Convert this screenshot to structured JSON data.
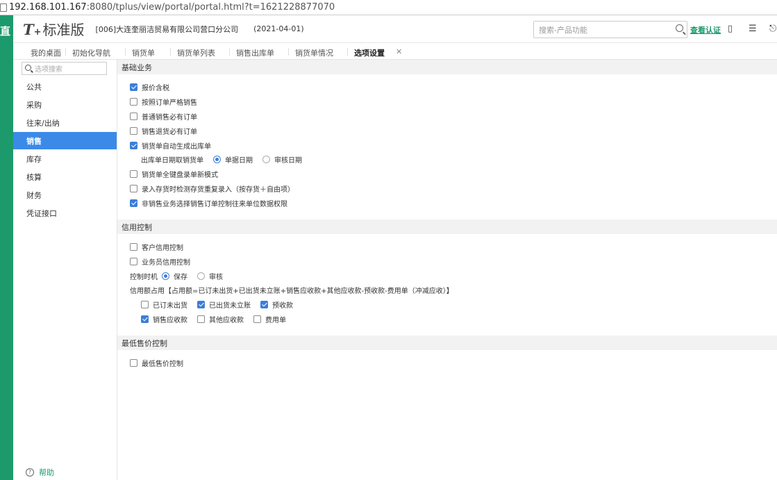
{
  "browser": {
    "url_host": "192.168.101.167",
    "url_path": ":8080/tplus/view/portal/portal.html?t=1621228877070"
  },
  "left_strip": {
    "char": "直"
  },
  "header": {
    "logo_t": "T",
    "logo_plus": "+",
    "logo_text": "标准版",
    "company": "[006]大连奎丽洁贸易有限公司营口分公司",
    "date": "(2021-04-01)",
    "search_placeholder": "搜索-产品功能",
    "verify_link": "查看认证"
  },
  "tabs": [
    {
      "label": "我的桌面"
    },
    {
      "label": "初始化导航"
    },
    {
      "label": "销货单"
    },
    {
      "label": "销货单列表"
    },
    {
      "label": "销售出库单"
    },
    {
      "label": "销货单情况"
    },
    {
      "label": "选项设置",
      "active": true
    }
  ],
  "sidebar": {
    "search_placeholder": "选项搜索",
    "items": [
      {
        "label": "公共"
      },
      {
        "label": "采购"
      },
      {
        "label": "往来/出纳"
      },
      {
        "label": "销售",
        "active": true
      },
      {
        "label": "库存"
      },
      {
        "label": "核算"
      },
      {
        "label": "财务"
      },
      {
        "label": "凭证接口"
      }
    ],
    "help_label": "帮助"
  },
  "sections": {
    "basic": {
      "title": "基础业务",
      "options": [
        {
          "label": "报价含税",
          "checked": true
        },
        {
          "label": "按照订单严格销售",
          "checked": false
        },
        {
          "label": "普通销售必有订单",
          "checked": false
        },
        {
          "label": "销售退货必有订单",
          "checked": false
        },
        {
          "label": "销货单自动生成出库单",
          "checked": true
        }
      ],
      "date_row": {
        "label": "出库单日期取销货单",
        "opt1": "单据日期",
        "opt2": "审核日期",
        "selected": "单据日期"
      },
      "options2": [
        {
          "label": "销货单全键盘录单新模式",
          "checked": false
        },
        {
          "label": "录入存货时检测存货重复录入（按存货＋自由项）",
          "checked": false
        },
        {
          "label": "非销售业务选择销售订单控制往来单位数据权限",
          "checked": true
        }
      ]
    },
    "credit": {
      "title": "信用控制",
      "options": [
        {
          "label": "客户信用控制",
          "checked": false
        },
        {
          "label": "业务员信用控制",
          "checked": false
        }
      ],
      "timing": {
        "label": "控制时机",
        "opt1": "保存",
        "opt2": "审核",
        "selected": "保存"
      },
      "formula": "信用额占用【占用额=已订未出货+已出货未立账+销售应收款+其他应收款-预收款-费用单（冲减应收）】",
      "items_row1": [
        {
          "label": "已订未出货",
          "checked": false
        },
        {
          "label": "已出货未立账",
          "checked": true
        },
        {
          "label": "预收款",
          "checked": true
        }
      ],
      "items_row2": [
        {
          "label": "销售应收款",
          "checked": true
        },
        {
          "label": "其他应收款",
          "checked": false
        },
        {
          "label": "费用单",
          "checked": false
        }
      ]
    },
    "minprice": {
      "title": "最低售价控制",
      "options": [
        {
          "label": "最低售价控制",
          "checked": false
        }
      ]
    }
  },
  "colors": {
    "brand_green": "#1d9a6c",
    "active_blue": "#3b8ae8",
    "checkbox_blue": "#3b7ed8"
  }
}
